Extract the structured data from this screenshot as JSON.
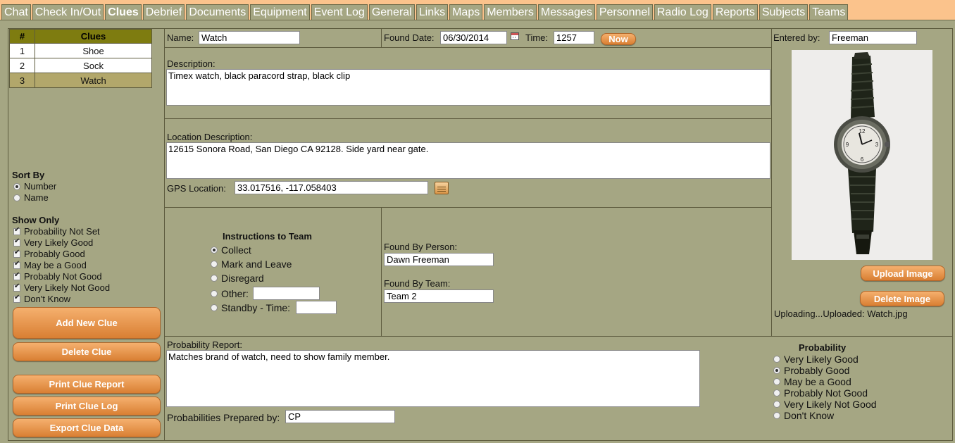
{
  "tabs": [
    "Chat",
    "Check In/Out",
    "Clues",
    "Debrief",
    "Documents",
    "Equipment",
    "Event Log",
    "General",
    "Links",
    "Maps",
    "Members",
    "Messages",
    "Personnel",
    "Radio Log",
    "Reports",
    "Subjects",
    "Teams"
  ],
  "active_tab": "Clues",
  "clue_list": {
    "col_number": "#",
    "col_clues": "Clues",
    "rows": [
      {
        "num": "1",
        "name": "Shoe"
      },
      {
        "num": "2",
        "name": "Sock"
      },
      {
        "num": "3",
        "name": "Watch"
      }
    ],
    "selected_index": 2
  },
  "sort_by": {
    "heading": "Sort By",
    "options": [
      "Number",
      "Name"
    ],
    "selected": "Number"
  },
  "show_only": {
    "heading": "Show Only",
    "options": [
      "Probability Not Set",
      "Very Likely Good",
      "Probably Good",
      "May be a Good",
      "Probably Not Good",
      "Very Likely Not Good",
      "Don't Know"
    ]
  },
  "buttons": {
    "add_new_clue": "Add New Clue",
    "delete_clue": "Delete Clue",
    "print_clue_report": "Print Clue Report",
    "print_clue_log": "Print Clue Log",
    "export_clue_data": "Export Clue Data",
    "now": "Now",
    "upload_image": "Upload Image",
    "delete_image": "Delete Image"
  },
  "clue": {
    "name_label": "Name:",
    "name": "Watch",
    "found_date_label": "Found Date:",
    "found_date": "06/30/2014",
    "time_label": "Time:",
    "time": "1257",
    "entered_by_label": "Entered by:",
    "entered_by": "Freeman",
    "description_label": "Description:",
    "description": "Timex watch, black paracord strap, black clip",
    "location_label": "Location Description:",
    "location": "12615 Sonora Road, San Diego CA 92128. Side yard near gate.",
    "gps_label": "GPS Location:",
    "gps": "33.017516, -117.058403",
    "upload_status": "Uploading...Uploaded: Watch.jpg"
  },
  "instructions": {
    "heading": "Instructions to Team",
    "options": [
      "Collect",
      "Mark and Leave",
      "Disregard",
      "Other:",
      "Standby - Time:"
    ],
    "selected": "Collect",
    "other_value": "",
    "standby_value": ""
  },
  "found_by": {
    "person_label": "Found By Person:",
    "person": "Dawn Freeman",
    "team_label": "Found By Team:",
    "team": "Team 2"
  },
  "probability_report": {
    "label": "Probability Report:",
    "text": "Matches brand of watch, need to show family member.",
    "prepared_by_label": "Probabilities Prepared by:",
    "prepared_by": "CP"
  },
  "probability": {
    "heading": "Probability",
    "options": [
      "Very Likely Good",
      "Probably Good",
      "May be a Good",
      "Probably Not Good",
      "Very Likely Not Good",
      "Don't Know"
    ],
    "selected": "Probably Good"
  },
  "colors": {
    "panel_bg": "#a5a683",
    "tab_bar_bg": "#fbc38c",
    "table_header_bg": "#7e7c10",
    "selected_row_bg": "#b2a76b",
    "button_orange": "#e08d44"
  },
  "icons": [
    "calendar-icon",
    "gps-picker-icon",
    "watch-photo"
  ]
}
